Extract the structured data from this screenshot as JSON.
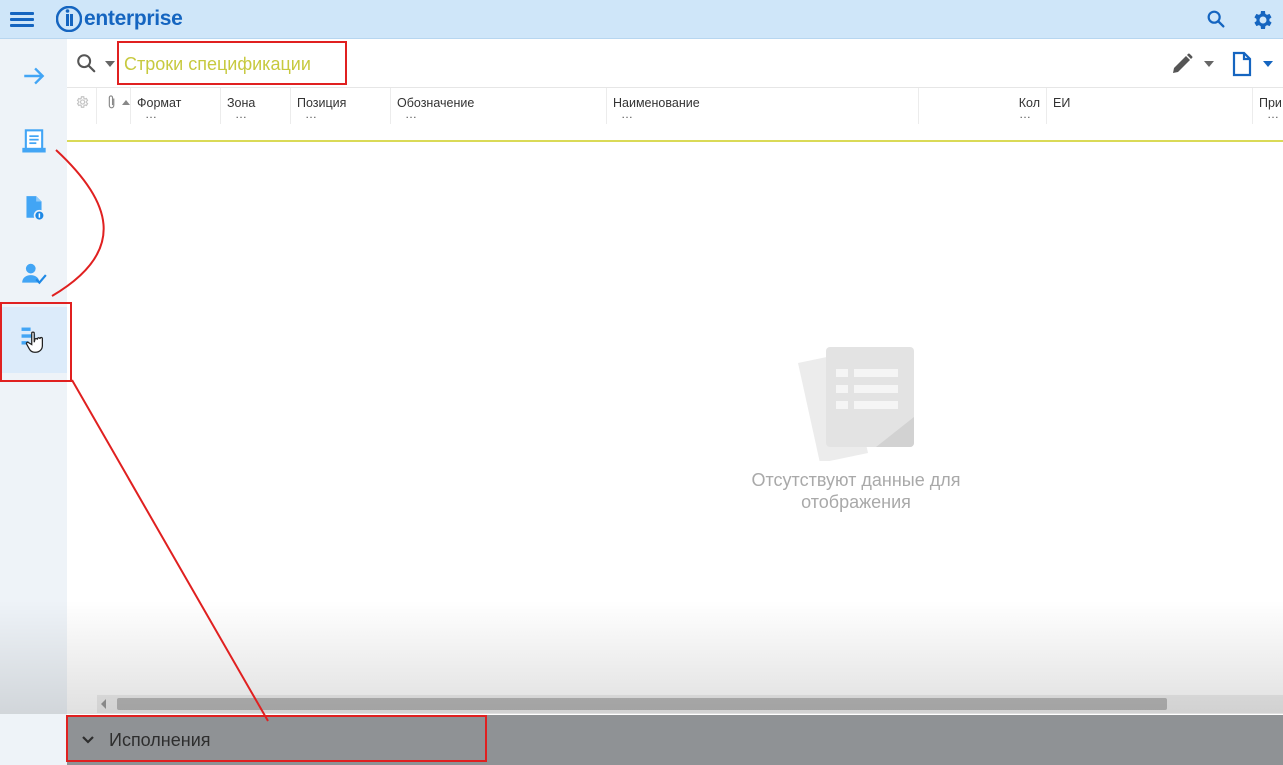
{
  "app": {
    "logo_text": "enterprise",
    "brand_color": "#1565c0"
  },
  "topbar": {
    "menu_icon": "hamburger-icon",
    "search_icon": "search-icon",
    "settings_icon": "gear-icon"
  },
  "sidebar": {
    "items": [
      {
        "icon": "arrow-right-icon",
        "active": false
      },
      {
        "icon": "document-list-icon",
        "active": false
      },
      {
        "icon": "file-info-icon",
        "active": false
      },
      {
        "icon": "user-check-icon",
        "active": false
      },
      {
        "icon": "spec-lines-icon",
        "active": true
      }
    ]
  },
  "grid": {
    "title": "Строки спецификации",
    "title_color": "#c7c93f",
    "columns": [
      {
        "label": "Формат"
      },
      {
        "label": "Зона"
      },
      {
        "label": "Позиция"
      },
      {
        "label": "Обозначение"
      },
      {
        "label": "Наименование"
      },
      {
        "label": "Кол"
      },
      {
        "label": "ЕИ"
      },
      {
        "label": "При"
      }
    ],
    "column_filter": "…",
    "empty_line1": "Отсутствуют данные для",
    "empty_line2": "отображения"
  },
  "section": {
    "label": "Исполнения"
  },
  "annotation_color": "#e02020"
}
